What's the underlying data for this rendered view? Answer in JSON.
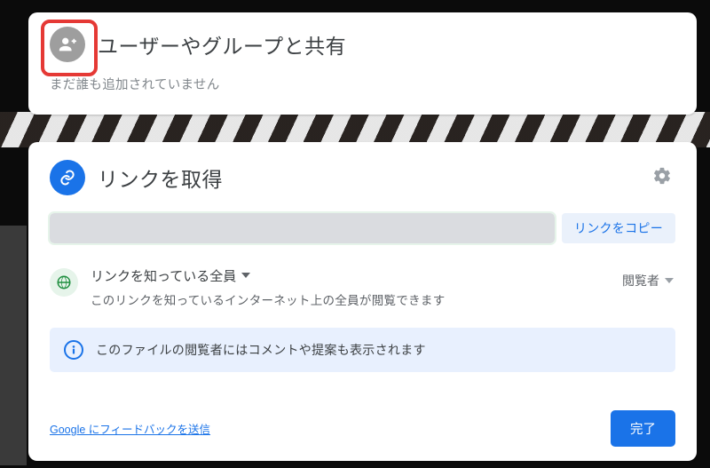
{
  "share_panel": {
    "title": "ユーザーやグループと共有",
    "subtitle": "まだ誰も追加されていません"
  },
  "link_panel": {
    "title": "リンクを取得",
    "copy_button": "リンクをコピー",
    "access": {
      "scope_label": "リンクを知っている全員",
      "scope_description": "このリンクを知っているインターネット上の全員が閲覧できます",
      "role_label": "閲覧者"
    },
    "info_banner": "このファイルの閲覧者にはコメントや提案も表示されます",
    "feedback_link": "Google にフィードバックを送信",
    "done_button": "完了"
  },
  "icons": {
    "person_add": "person-add-icon",
    "link": "link-icon",
    "gear": "gear-icon",
    "globe": "globe-icon",
    "info": "info-icon",
    "caret": "caret-down-icon"
  },
  "colors": {
    "primary": "#1a73e8",
    "highlight_border": "#e53935",
    "success": "#1e8e3e"
  }
}
